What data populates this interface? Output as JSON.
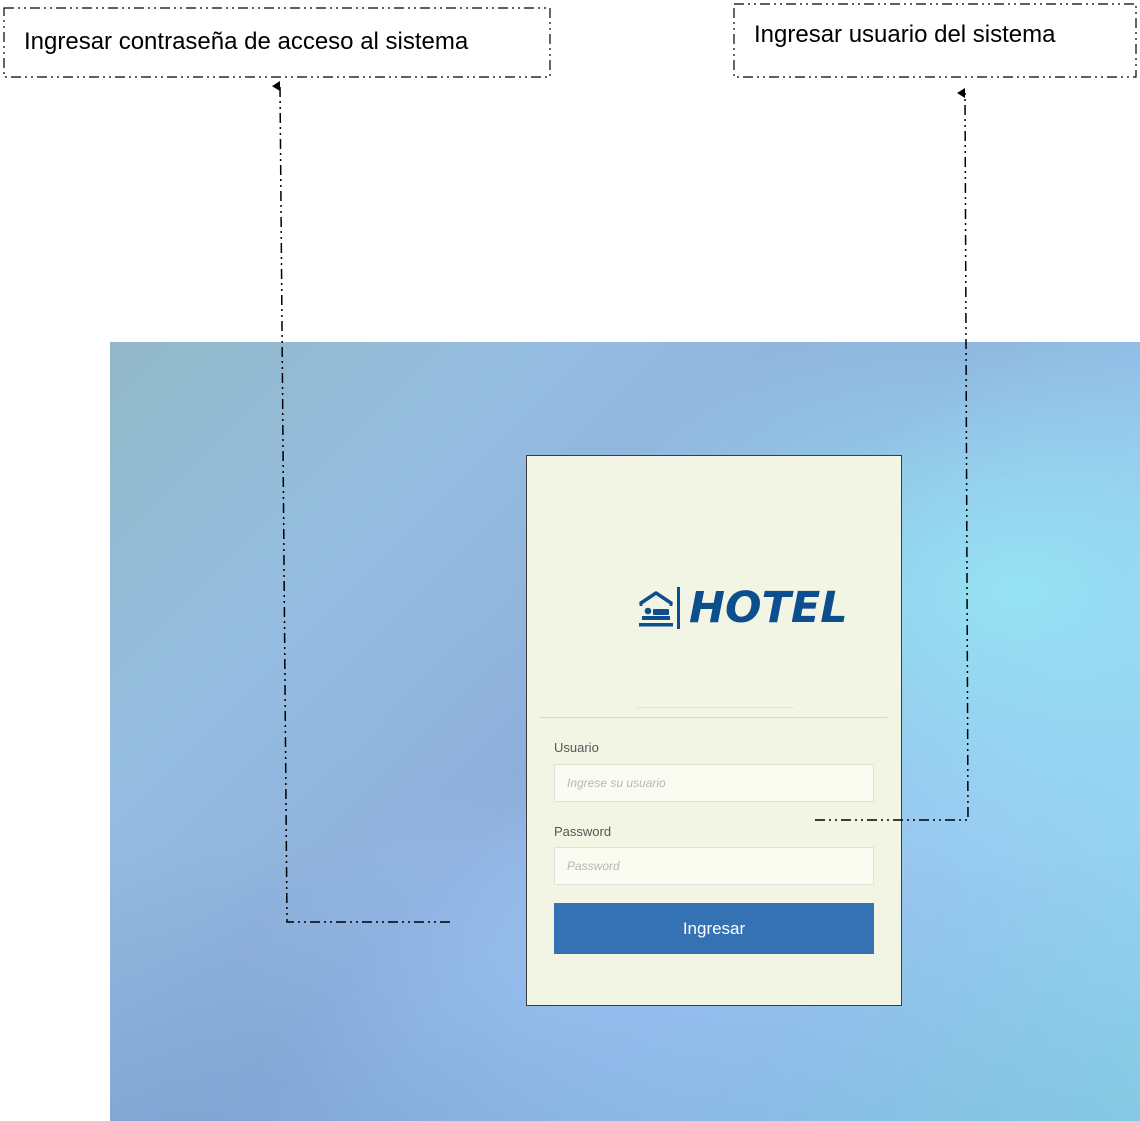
{
  "annotations": {
    "password_note": "Ingresar contraseña de acceso al sistema",
    "user_note": "Ingresar usuario del sistema"
  },
  "login": {
    "logo_icon": "hotel-bed-icon",
    "logo_text": "HOTEL",
    "user_label": "Usuario",
    "user_placeholder": "Ingrese su usuario",
    "user_value": "",
    "password_label": "Password",
    "password_placeholder": "Password",
    "password_value": "",
    "submit_label": "Ingresar"
  },
  "colors": {
    "logo": "#0d4e8e",
    "button": "#3572b4",
    "card": "#f3f5e4",
    "card_border": "#3d3d3d"
  }
}
